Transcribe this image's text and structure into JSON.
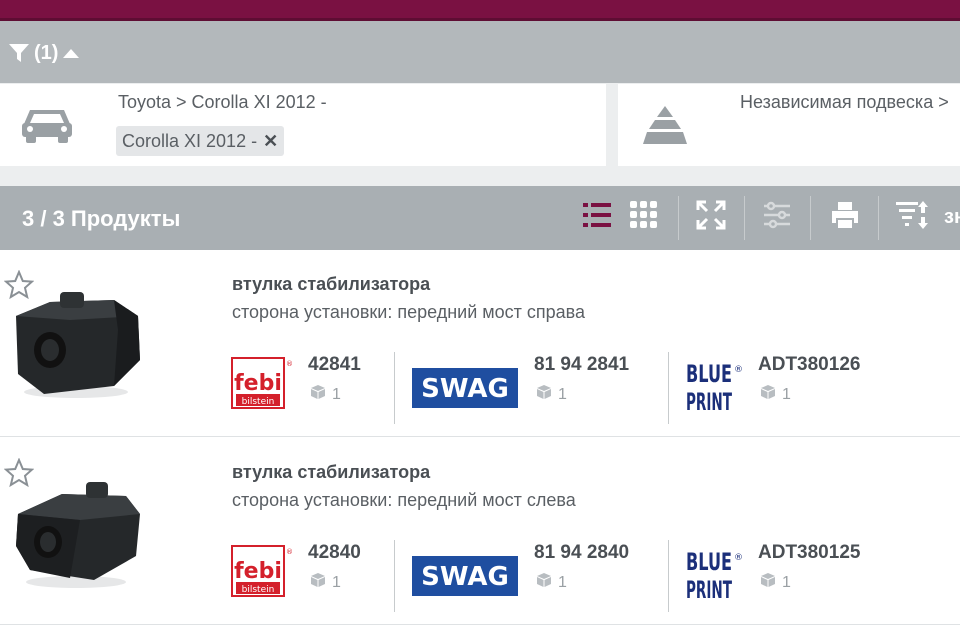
{
  "filter": {
    "toggle_label": "(1)"
  },
  "vehicle": {
    "breadcrumb": "Toyota > Corolla XI 2012 -",
    "chip": "Corolla XI 2012 -",
    "chip_remove": "✕"
  },
  "category": {
    "label": "Независимая подвеска >"
  },
  "results": {
    "count_label": "3 / 3 Продукты",
    "sort_label": "зн"
  },
  "products": [
    {
      "name": "втулка стабилизатора",
      "spec": "сторона установки: передний мост справа",
      "offers": [
        {
          "brand": "febi",
          "brand_sub": "bilstein",
          "number": "42841",
          "qty": "1"
        },
        {
          "brand": "SWAG",
          "number": "81 94 2841",
          "qty": "1"
        },
        {
          "brand": "BLUE",
          "brand_sub": "PRINT",
          "number": "ADT380126",
          "qty": "1"
        }
      ]
    },
    {
      "name": "втулка стабилизатора",
      "spec": "сторона установки: передний мост слева",
      "offers": [
        {
          "brand": "febi",
          "brand_sub": "bilstein",
          "number": "42840",
          "qty": "1"
        },
        {
          "brand": "SWAG",
          "number": "81 94 2840",
          "qty": "1"
        },
        {
          "brand": "BLUE",
          "brand_sub": "PRINT",
          "number": "ADT380125",
          "qty": "1"
        }
      ]
    }
  ],
  "colors": {
    "brand_accent": "#7a1142",
    "febi_red": "#d4202b",
    "swag_blue": "#1f4ea0",
    "blueprint_navy": "#1b2f7a"
  },
  "icons": [
    "filter-icon",
    "caret-up-icon",
    "car-icon",
    "category-pyramid-icon",
    "list-view-icon",
    "grid-view-icon",
    "expand-icon",
    "filter-sliders-icon",
    "print-icon",
    "sort-icon",
    "star-icon",
    "box-icon"
  ]
}
